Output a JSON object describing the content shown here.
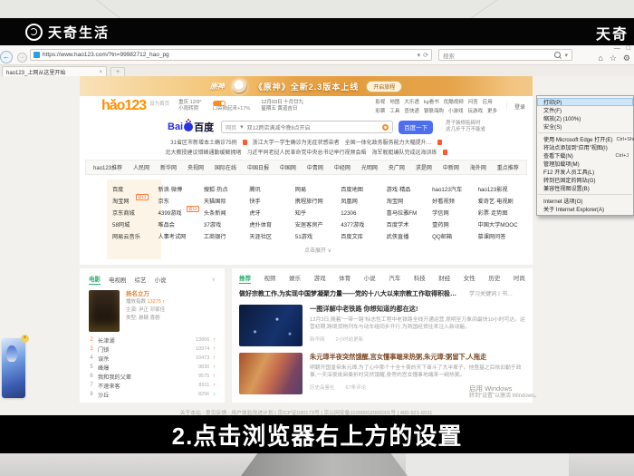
{
  "brand": {
    "name": "天奇生活",
    "partial": "天奇"
  },
  "caption": "2.点击浏览器右上方的设置",
  "browser": {
    "url": "https://www.hao123.com/?tn=99982712_hao_pg",
    "tab_title": "hao123_上网从这里开始",
    "search_placeholder": "搜索",
    "min": "—",
    "max": "□",
    "back": "←",
    "fwd": "→",
    "refresh": "⟳",
    "compat": "▾",
    "home": "⌂",
    "star": "☆",
    "gear": "⚙",
    "close_tab": "×",
    "new_tab": "+"
  },
  "menu": {
    "group1": [
      {
        "label": "打印(P)",
        "shortcut": ""
      },
      {
        "label": "文件(F)",
        "shortcut": ""
      },
      {
        "label": "缩放(Z) (100%)",
        "shortcut": ""
      },
      {
        "label": "安全(S)",
        "shortcut": ""
      }
    ],
    "group2": [
      {
        "label": "使用 Microsoft Edge 打开(E)",
        "shortcut": "Ctrl+Shift+E"
      },
      {
        "label": "将站点添加到“应用”视图(I)",
        "shortcut": ""
      },
      {
        "label": "查看下载(N)",
        "shortcut": "Ctrl+J"
      },
      {
        "label": "管理加载项(M)",
        "shortcut": ""
      },
      {
        "label": "F12 开发人员工具(L)",
        "shortcut": ""
      },
      {
        "label": "转到已固定的网站(G)",
        "shortcut": ""
      },
      {
        "label": "兼容性视图设置(B)",
        "shortcut": ""
      }
    ],
    "group3": [
      {
        "label": "Internet 选项(O)",
        "shortcut": ""
      },
      {
        "label": "关于 Internet Explorer(A)",
        "shortcut": ""
      }
    ]
  },
  "banner": {
    "game": "原神",
    "title": "《原神》全新2.3版本上线",
    "cta": "开启旅程"
  },
  "header": {
    "logo": "hǎo123",
    "set_home": "设为首页",
    "weather_city": "重庆 12/9°",
    "weather_cond": "小雨转阴",
    "promo1": "领现金红包",
    "promo2": "口袋鼓起来+17%",
    "date": "12月03日 十月廿九",
    "week": "星期五 黄道吉日",
    "links_row1": [
      "影视",
      "地图",
      "大乐透",
      "kg看书",
      "优酷视频",
      "问答",
      "应用"
    ],
    "links_row2": [
      "彩票",
      "工具",
      "查快递",
      "银联海购",
      "小游戏",
      "玩游戏",
      "更多"
    ],
    "login": "登录"
  },
  "search": {
    "logo_bai": "Bai",
    "logo_cn": "百度",
    "scope": "网页",
    "query": "双12跨店满减今晚8点开启",
    "button": "百度一下",
    "side1": "房子装修贴砖时",
    "side2": "这几步千万不能省"
  },
  "ticker": {
    "l1a": "31省区市新增本土确诊75例",
    "l1b": "浙江大学一学生确诊为无症状感染者",
    "l1c": "全国一体化政务服务能力大幅提升…",
    "l2a": "北大教授建议错峰通勤缓解拥堵",
    "l2b": "习近平同老挝人民革命党中央总书记举行视频会晤",
    "l2c": "海军舰艇编队完成远海训练"
  },
  "nav": [
    "hao123推荐",
    "人民网",
    "新华网",
    "央视网",
    "国际在线",
    "中国日报",
    "中国网",
    "中青网",
    "中经网",
    "光明网",
    "央广网",
    "求是网",
    "中新网",
    "海外网",
    "重点推荐"
  ],
  "grid": {
    "rows": [
      [
        "百度",
        "新浪·微博",
        "搜狐·热点",
        "腾讯",
        "网易",
        "百度地图",
        "游戏·精品",
        "hao123汽车",
        "hao123影视"
      ],
      [
        "淘宝网",
        "京东",
        "天猫国际",
        "快手",
        "携程旅行网",
        "凤凰网",
        "淘宝网",
        "好看视频",
        "爱奇艺·电视剧"
      ],
      [
        "京东商城",
        "4399游戏",
        "头条新闻",
        "虎牙",
        "知乎",
        "12306",
        "喜马拉雅FM",
        "学信网",
        "彩票·走势图"
      ],
      [
        "58同城",
        "唯品会",
        "37游戏",
        "虎扑体育",
        "安居客房产",
        "4377游戏",
        "百度学术",
        "壹药网",
        "中国大学MOOC"
      ],
      [
        "网易云音乐",
        "人事考试网",
        "工商银行",
        "天涯社区",
        "51游戏",
        "百度文库",
        "武侠直播",
        "QQ邮箱",
        "慕课网问答"
      ]
    ],
    "badge": "双12",
    "expand": "点击展开 ∨"
  },
  "movies": {
    "tabs": [
      "电影",
      "电视剧",
      "综艺",
      "小说"
    ],
    "more": "∨",
    "featured": {
      "rank": "1",
      "title": "扬名立万",
      "stat_label": "播放指数",
      "stat_value": "13275",
      "arrow": "↑",
      "cast": "主演: 尹正 邓家佳",
      "genre": "类型: 悬疑 喜剧"
    },
    "list": [
      {
        "rank": "2",
        "title": "长津湖",
        "value": "13806",
        "arrow": "↑"
      },
      {
        "rank": "3",
        "title": "门锁",
        "value": "10974",
        "arrow": "↑"
      },
      {
        "rank": "4",
        "title": "误杀",
        "value": "10473",
        "arrow": "↑"
      },
      {
        "rank": "5",
        "title": "峰爆",
        "value": "9830",
        "arrow": "↑"
      },
      {
        "rank": "6",
        "title": "我和我的父辈",
        "value": "9575",
        "arrow": "↑"
      },
      {
        "rank": "7",
        "title": "不速来客",
        "value": "8911",
        "arrow": "↑"
      },
      {
        "rank": "8",
        "title": "沙丘",
        "value": "8256",
        "arrow": "↓"
      }
    ]
  },
  "feed": {
    "tabs": [
      "推荐",
      "视频",
      "娱乐",
      "游戏",
      "体育",
      "小说",
      "汽车",
      "科技",
      "财经",
      "女性",
      "历史",
      "时尚"
    ],
    "headline": "做好宗教工作,为实现中国梦凝聚力量——党的十八大以来宗教工作取得积极成效",
    "headline_tag": "学习关键词丨书…",
    "articles": [
      {
        "title": "一图详解中老铁路 你想知道的都在这!",
        "snippet": "12月3日,随着“一带一路”标志性工程中老铁路全线开通运营,昆明至万象间最快10小时可达。运营初期,跨境货物列车与动车组同步开行,为两国经贸往来注入新动能。",
        "source": "新华网",
        "meta": "2小时前更新"
      },
      {
        "title": "朱元璋半夜突然饿醒,宫女懂事端来热粥,朱元璋:粥留下,人拖走",
        "snippet": "明朝开国皇帝朱元璋,为了心中那个十全十美的天下奋斗了大半辈子。他登基之后依旧勤于政事,一天深夜批阅奏折时突然饿醒,身旁的宫女懂事地端来一碗热粥。",
        "source": "历史品鉴社",
        "meta": "67条评论"
      }
    ]
  },
  "footer": "关于本站 · 意见反馈 · 用户体验改进计划 | 京ICP证030173号 | 京公网安备11000002000001号 | 400-921-6011",
  "activate": {
    "l1": "启用 Windows",
    "l2": "转到“设置”以激活 Windows。"
  },
  "colors": {
    "accent_orange": "#ff9000",
    "baidu_blue": "#4e6ef2",
    "hao_green": "#2fae6e",
    "banner_orange": "#eda94f",
    "menu_highlight": "#cde6f8",
    "hot_red": "#ff5a2d"
  }
}
